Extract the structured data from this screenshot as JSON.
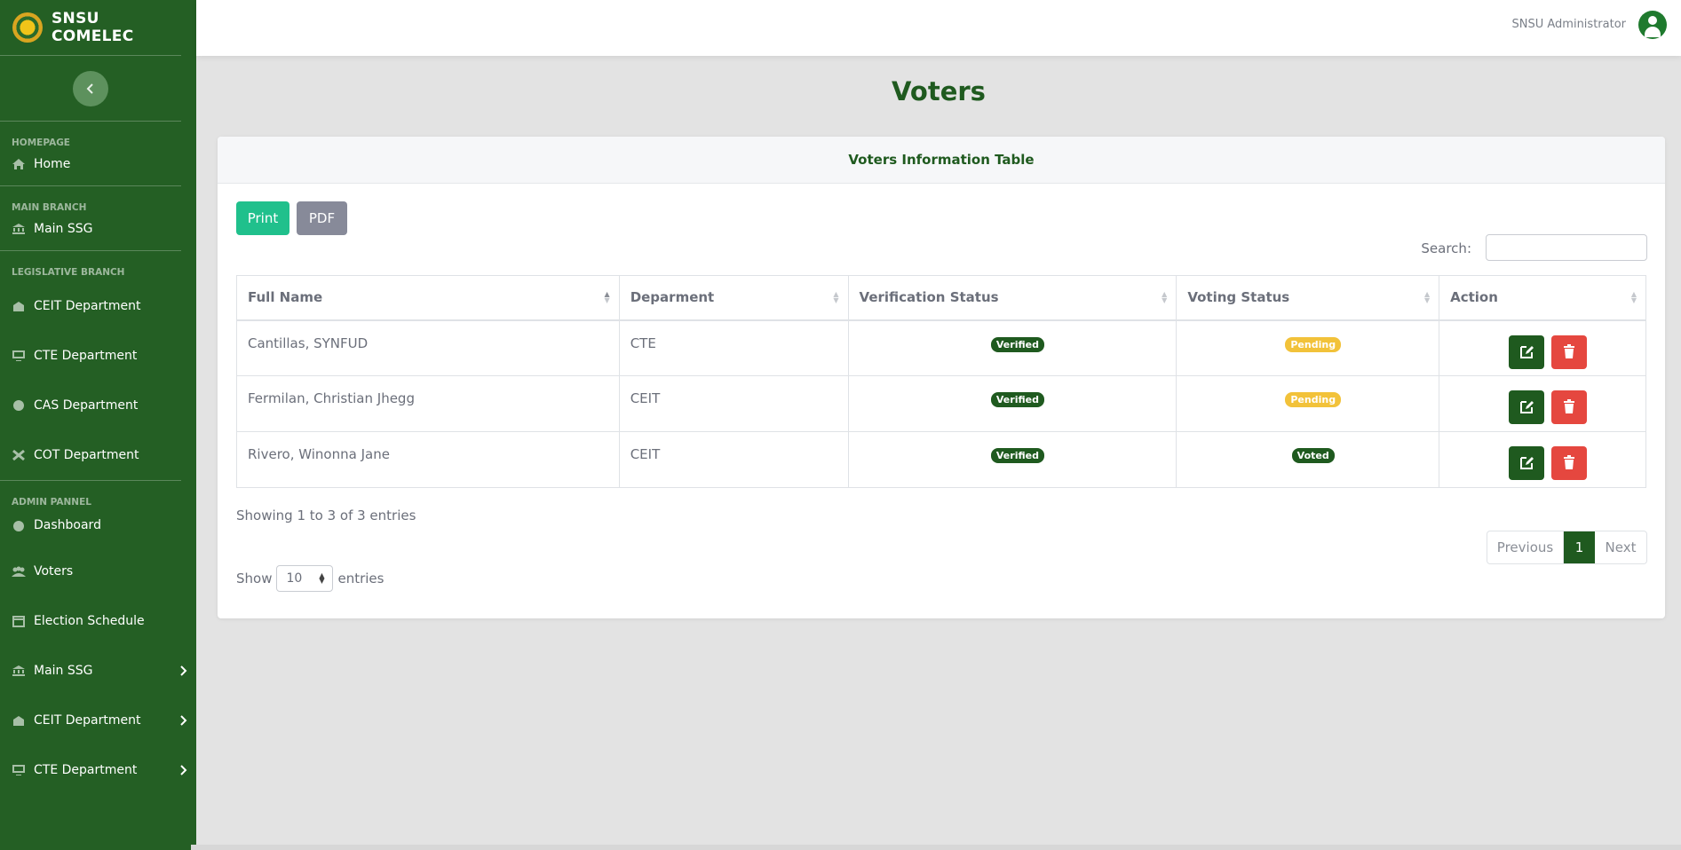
{
  "brand": {
    "name": "SNSU COMELEC",
    "logo_icon": "snsu-seal-logo"
  },
  "topbar": {
    "user_name": "SNSU Administrator",
    "avatar_icon": "user-circle-icon"
  },
  "sidebar": {
    "sections": [
      {
        "heading": "HOMEPAGE",
        "items": [
          {
            "label": "Home",
            "icon": "home-icon"
          }
        ]
      },
      {
        "heading": "MAIN BRANCH",
        "items": [
          {
            "label": "Main SSG",
            "icon": "landmark-icon"
          }
        ]
      },
      {
        "heading": "LEGISLATIVE BRANCH",
        "items": [
          {
            "label": "CEIT Department",
            "icon": "building-icon"
          },
          {
            "label": "CTE Department",
            "icon": "chalkboard-icon"
          },
          {
            "label": "CAS Department",
            "icon": "atom-icon"
          },
          {
            "label": "COT Department",
            "icon": "tools-icon"
          }
        ]
      },
      {
        "heading": "ADMIN PANNEL",
        "items": [
          {
            "label": "Dashboard",
            "icon": "gauge-icon"
          },
          {
            "label": "Voters",
            "icon": "users-icon"
          },
          {
            "label": "Election Schedule",
            "icon": "calendar-icon"
          },
          {
            "label": "Main SSG",
            "icon": "landmark-icon",
            "chevron": true
          },
          {
            "label": "CEIT Department",
            "icon": "building-icon",
            "chevron": true
          },
          {
            "label": "CTE Department",
            "icon": "chalkboard-icon",
            "chevron": true
          }
        ]
      }
    ]
  },
  "page": {
    "title": "Voters"
  },
  "card": {
    "title": "Voters Information Table",
    "print_label": "Print",
    "pdf_label": "PDF",
    "search_label": "Search:",
    "columns": [
      "Full Name",
      "Deparment",
      "Verification Status",
      "Voting Status",
      "Action"
    ],
    "rows": [
      {
        "name": "Cantillas, SYNFUD",
        "department": "CTE",
        "verification": "Verified",
        "voting": "Pending"
      },
      {
        "name": "Fermilan, Christian Jhegg",
        "department": "CEIT",
        "verification": "Verified",
        "voting": "Pending"
      },
      {
        "name": "Rivero, Winonna Jane",
        "department": "CEIT",
        "verification": "Verified",
        "voting": "Voted"
      }
    ],
    "info": "Showing 1 to 3 of 3 entries",
    "pager": {
      "previous": "Previous",
      "current": "1",
      "next": "Next"
    },
    "show_label": "Show",
    "entries_value": "10",
    "entries_label": "entries"
  },
  "colors": {
    "sidebar_bg": "#245f24",
    "accent_green": "#1f5a1f",
    "print_btn": "#20c08c",
    "pdf_btn": "#878a99",
    "pending_badge": "#f2c23a",
    "delete_btn": "#e5473f"
  }
}
